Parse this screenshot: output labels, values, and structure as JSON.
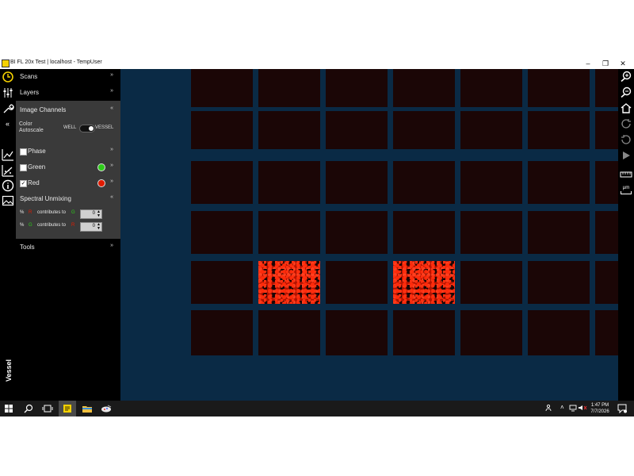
{
  "window": {
    "title": "BI FL 20x Test | localhost - TempUser",
    "minimize": "–",
    "maximize": "❐",
    "close": "✕"
  },
  "rail": {
    "collapse": "«",
    "vertical_label": "Vessel"
  },
  "panel": {
    "scans": {
      "label": "Scans",
      "chevron": "»"
    },
    "layers": {
      "label": "Layers",
      "chevron": "»"
    },
    "image_channels": {
      "label": "Image Channels",
      "chevron": "«"
    },
    "color_autoscale": {
      "label_line1": "Color",
      "label_line2": "Autoscale",
      "option_left": "WELL",
      "option_right": "VESSEL",
      "selected": "VESSEL"
    },
    "channels": [
      {
        "label": "Phase",
        "checked": false,
        "checkmark": "",
        "color": "",
        "chevron": "»"
      },
      {
        "label": "Green",
        "checked": false,
        "checkmark": "",
        "color": "#2ecc1a",
        "chevron": "»"
      },
      {
        "label": "Red",
        "checked": true,
        "checkmark": "✓",
        "color": "#e01b00",
        "chevron": "»"
      }
    ],
    "spectral_unmixing": {
      "label": "Spectral Unmixing",
      "chevron": "«",
      "rows": [
        {
          "pct": "%",
          "from": "R",
          "from_color": "#e01b00",
          "text": "contributes to",
          "to": "G",
          "to_color": "#2ecc1a",
          "value": "0"
        },
        {
          "pct": "%",
          "from": "G",
          "from_color": "#2ecc1a",
          "text": "contributes to",
          "to": "R",
          "to_color": "#e01b00",
          "value": "0"
        }
      ]
    },
    "tools": {
      "label": "Tools",
      "chevron": "»"
    }
  },
  "right_toolbar": {
    "icons": [
      "zoom-in-icon",
      "zoom-out-icon",
      "home-icon",
      "rotate-icon",
      "history-icon",
      "play-icon",
      "ruler-icon",
      "micrometer-icon"
    ],
    "um_label": "µm"
  },
  "viewport": {
    "background": "#0a2a45",
    "lit_wells": [
      "row5-col2",
      "row5-col4"
    ]
  },
  "taskbar": {
    "time": "1:47 PM",
    "date": "7/7/2026"
  }
}
